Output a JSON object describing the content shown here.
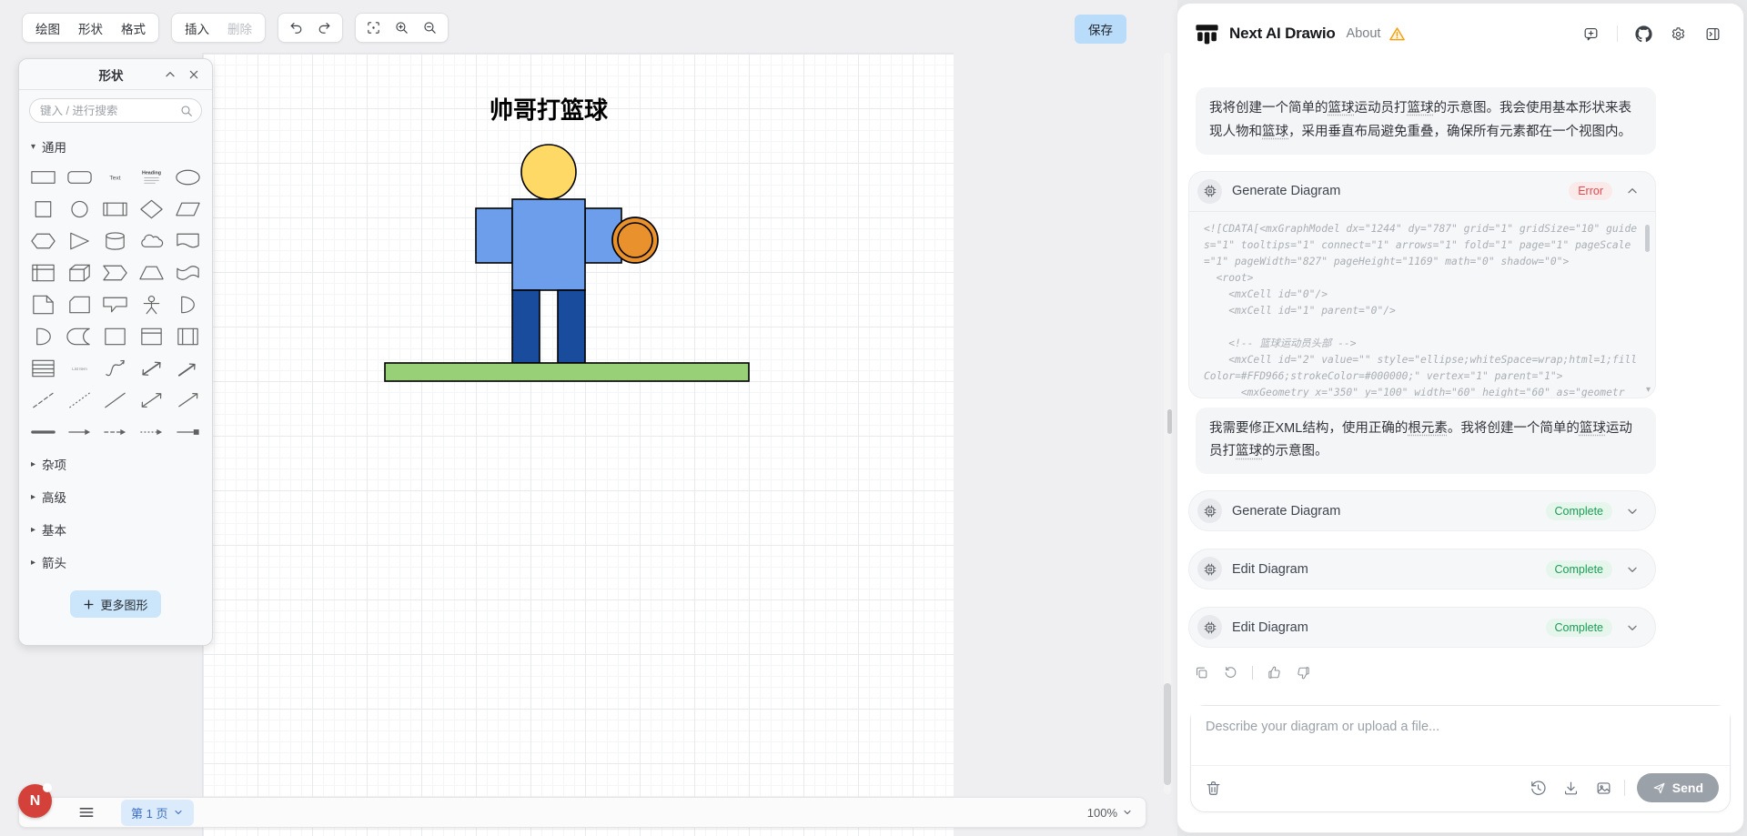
{
  "editor": {
    "toolbar": {
      "draw": "绘图",
      "shape": "形状",
      "format": "格式",
      "insert": "插入",
      "delete": "删除",
      "save": "保存",
      "icon_buttons": [
        "undo",
        "redo",
        "fit-view",
        "zoom-in",
        "zoom-out"
      ]
    },
    "shapes_panel": {
      "title": "形状",
      "search_placeholder": "键入 / 进行搜索",
      "sections": {
        "general": "通用",
        "misc": "杂项",
        "advanced": "高级",
        "basic": "基本",
        "arrows": "箭头"
      },
      "more_shapes": "更多图形",
      "shapes": [
        "rectangle",
        "rounded-rectangle",
        "text",
        "heading",
        "ellipse",
        "square",
        "circle",
        "process",
        "diamond",
        "parallelogram",
        "hexagon",
        "triangle",
        "cylinder",
        "cloud",
        "document",
        "internal-storage",
        "cube",
        "step",
        "trapezoid",
        "tape",
        "note",
        "card",
        "callout",
        "actor",
        "or",
        "and",
        "data-storage",
        "container",
        "vertical-container",
        "horizontal-container",
        "list",
        "list-item",
        "curve",
        "bidirectional-arrow",
        "arrow",
        "dashed-line",
        "dotted-line",
        "line",
        "bidirectional-connector",
        "directional-connector",
        "link",
        "simple-arrow",
        "dashed-arrow",
        "dotted-arrow",
        "arrow-with-box"
      ]
    },
    "bottom_bar": {
      "page": "第 1 页",
      "zoom": "100%",
      "avatar_letter": "N"
    },
    "diagram": {
      "title": "帅哥打篮球",
      "head_color": "#FFD966",
      "body_color": "#6D9EEB",
      "arm_color": "#6D9EEB",
      "leg_color": "#1A4C9E",
      "ball_color": "#E8912D",
      "ground_color": "#97D077",
      "stroke_color": "#000000"
    }
  },
  "chat": {
    "brand": "Next AI Drawio",
    "about": "About",
    "header_icons": [
      "feedback",
      "github",
      "settings",
      "collapse-panel"
    ],
    "blocks": [
      {
        "type": "text",
        "text": "我将创建一个简单的篮球运动员打篮球的示意图。我会使用基本形状来表现人物和篮球，采用垂直布局避免重叠，确保所有元素都在一个视图内。"
      },
      {
        "type": "tool",
        "label": "Generate Diagram",
        "status": "Error",
        "status_color": "red",
        "expanded": true,
        "code": "<![CDATA[<mxGraphModel dx=\"1244\" dy=\"787\" grid=\"1\" gridSize=\"10\" guides=\"1\" tooltips=\"1\" connect=\"1\" arrows=\"1\" fold=\"1\" page=\"1\" pageScale=\"1\" pageWidth=\"827\" pageHeight=\"1169\" math=\"0\" shadow=\"0\">\n  <root>\n    <mxCell id=\"0\"/>\n    <mxCell id=\"1\" parent=\"0\"/>\n\n    <!-- 篮球运动员头部 -->\n    <mxCell id=\"2\" value=\"\" style=\"ellipse;whiteSpace=wrap;html=1;fillColor=#FFD966;strokeColor=#000000;\" vertex=\"1\" parent=\"1\">\n      <mxGeometry x=\"350\" y=\"100\" width=\"60\" height=\"60\" as=\"geometr"
      },
      {
        "type": "text",
        "text": "我需要修正XML结构，使用正确的根元素。我将创建一个简单的篮球运动员打篮球的示意图。"
      },
      {
        "type": "tool",
        "label": "Generate Diagram",
        "status": "Complete",
        "status_color": "green",
        "expanded": false
      },
      {
        "type": "tool",
        "label": "Edit Diagram",
        "status": "Complete",
        "status_color": "green",
        "expanded": false
      },
      {
        "type": "tool",
        "label": "Edit Diagram",
        "status": "Complete",
        "status_color": "green",
        "expanded": false
      },
      {
        "type": "actions",
        "icons": [
          "copy",
          "retry",
          "divider",
          "thumb-up",
          "thumb-down"
        ]
      }
    ],
    "spellcheck_terms": [
      "篮球",
      "根元素"
    ],
    "input": {
      "placeholder": "Describe your diagram or upload a file...",
      "send": "Send",
      "icons": [
        "history",
        "download",
        "image"
      ]
    }
  }
}
